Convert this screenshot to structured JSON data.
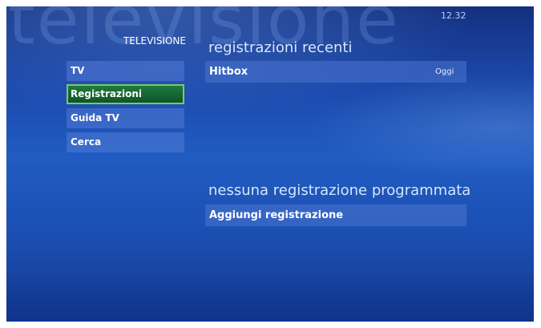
{
  "watermark": "televisione",
  "clock": "12.32",
  "section_title": "TELEVISIONE",
  "menu": {
    "items": [
      {
        "label": "TV",
        "selected": false
      },
      {
        "label": "Registrazioni",
        "selected": true
      },
      {
        "label": "Guida TV",
        "selected": false
      },
      {
        "label": "Cerca",
        "selected": false
      }
    ]
  },
  "recent": {
    "heading": "registrazioni recenti",
    "items": [
      {
        "title": "Hitbox",
        "when": "Oggi"
      }
    ]
  },
  "scheduled": {
    "heading": "nessuna registrazione programmata",
    "add_label": "Aggiungi registrazione"
  },
  "colors": {
    "selected_fill": "#1f7a3c",
    "selected_border": "#7bc86e",
    "background": "#215cc2"
  }
}
